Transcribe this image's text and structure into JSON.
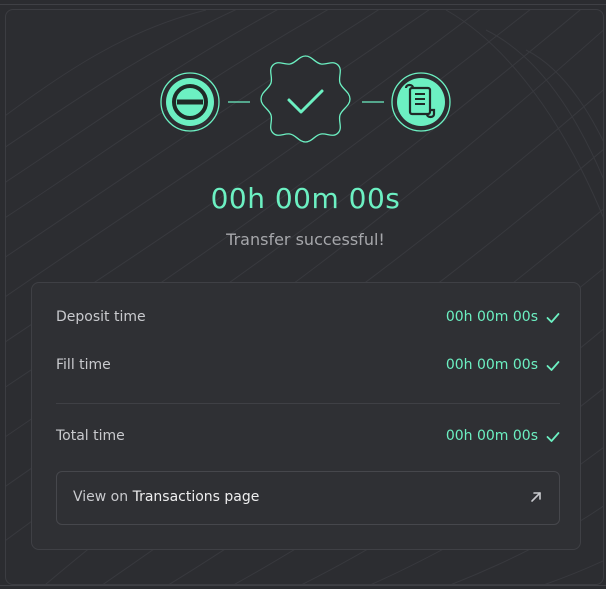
{
  "status": {
    "timer": "00h 00m 00s",
    "message": "Transfer successful!"
  },
  "steps": [
    {
      "name": "source-chain-icon",
      "state": "complete"
    },
    {
      "name": "success-badge-icon",
      "state": "complete"
    },
    {
      "name": "receipt-scroll-icon",
      "state": "complete"
    }
  ],
  "details": {
    "rows": [
      {
        "label": "Deposit time",
        "value": "00h 00m 00s"
      },
      {
        "label": "Fill time",
        "value": "00h 00m 00s"
      }
    ],
    "total": {
      "label": "Total time",
      "value": "00h 00m 00s"
    },
    "link": {
      "prefix": "View on",
      "target": "Transactions page"
    }
  },
  "colors": {
    "accent": "#6cf0c2",
    "background": "#2b2c30",
    "panel": "#2f3034",
    "text_muted": "#a6a7ab"
  }
}
